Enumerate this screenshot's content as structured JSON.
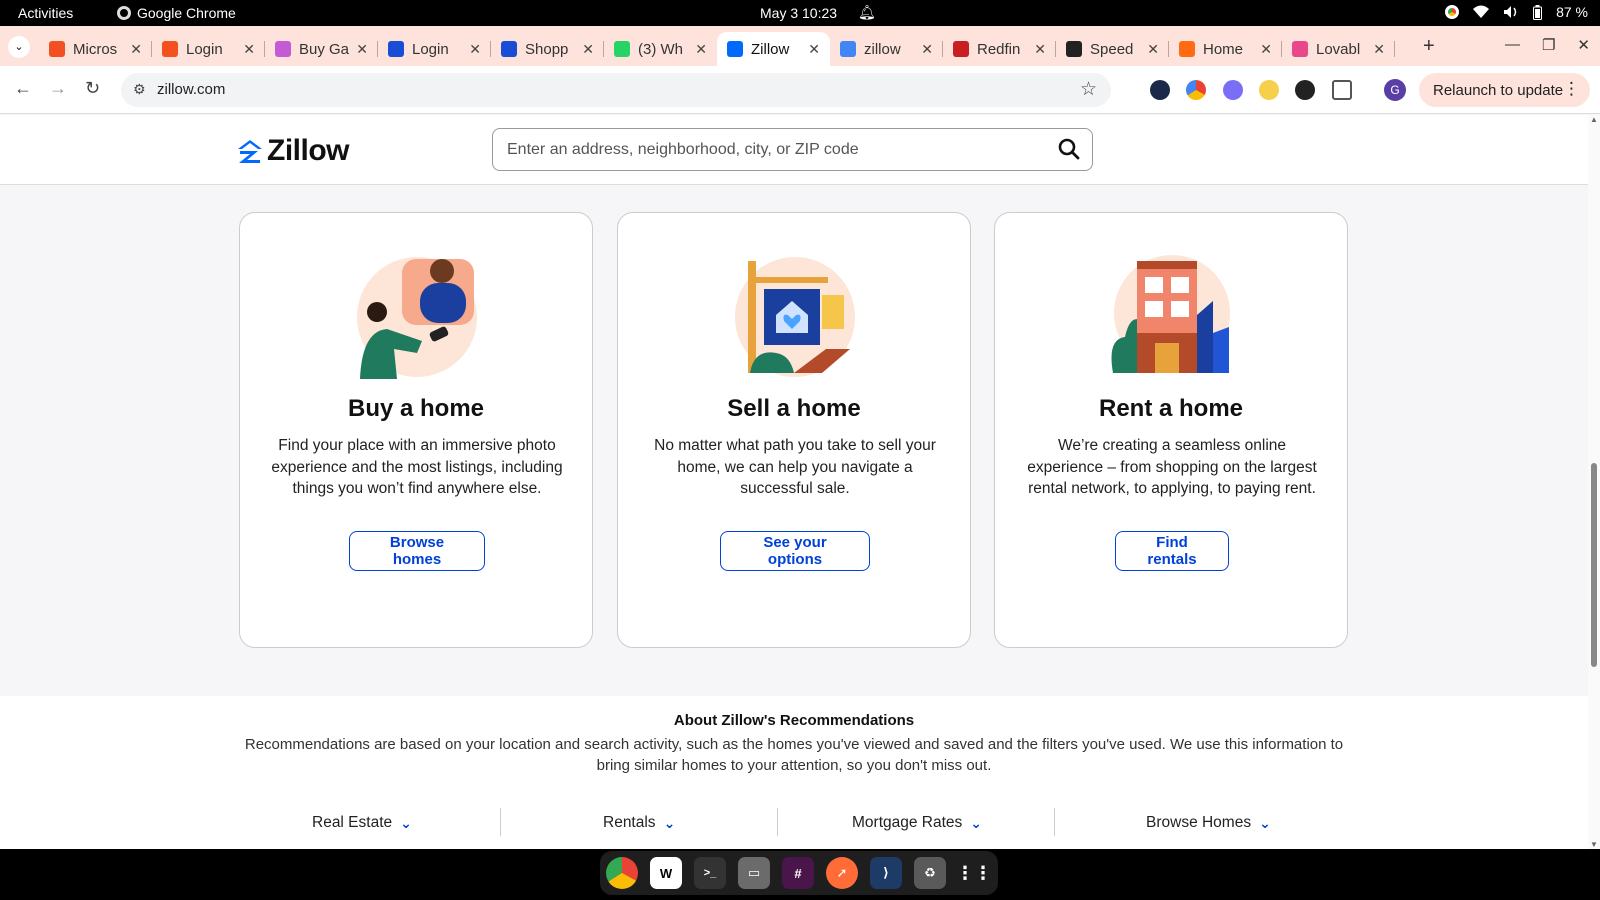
{
  "system_bar": {
    "activities": "Activities",
    "app_name": "Google Chrome",
    "clock": "May 3  10:23",
    "battery": "87 %"
  },
  "tabs": [
    {
      "title": "Micros",
      "color": "#f25022",
      "icon": "microsoft-icon"
    },
    {
      "title": "Login",
      "color": "#f4511e",
      "icon": "g-logo-icon"
    },
    {
      "title": "Buy Ga",
      "color": "#c45bd6",
      "icon": "pinwheel-icon"
    },
    {
      "title": "Login",
      "color": "#1a4dd6",
      "icon": "w-logo-icon"
    },
    {
      "title": "Shopp",
      "color": "#1a4dd6",
      "icon": "w-logo-icon"
    },
    {
      "title": "(3) Wh",
      "color": "#25d366",
      "icon": "whatsapp-icon"
    },
    {
      "title": "Zillow",
      "color": "#006aff",
      "icon": "zillow-icon"
    },
    {
      "title": "zillow",
      "color": "#4285f4",
      "icon": "google-icon"
    },
    {
      "title": "Redfin",
      "color": "#c82021",
      "icon": "redfin-icon"
    },
    {
      "title": "Speed",
      "color": "#222222",
      "icon": "speedtest-icon"
    },
    {
      "title": "Home",
      "color": "#ff6a13",
      "icon": "home-app-icon"
    },
    {
      "title": "Lovabl",
      "color": "#e8488b",
      "icon": "lovable-icon"
    }
  ],
  "active_tab_index": 6,
  "address_bar": {
    "url": "zillow.com",
    "relaunch_label": "Relaunch to update",
    "profile_initial": "G"
  },
  "zillow": {
    "brand": "Zillow",
    "brand_color": "#006aff",
    "search_placeholder": "Enter an address, neighborhood, city, or ZIP code",
    "cards": [
      {
        "title": "Buy a home",
        "description": "Find your place with an immersive photo experience and the most listings, including things you won’t find anywhere else.",
        "cta": "Browse homes"
      },
      {
        "title": "Sell a home",
        "description": "No matter what path you take to sell your home, we can help you navigate a successful sale.",
        "cta": "See your options"
      },
      {
        "title": "Rent a home",
        "description": "We’re creating a seamless online experience – from shopping on the largest rental network, to applying, to paying rent.",
        "cta": "Find rentals"
      }
    ],
    "about": {
      "heading": "About Zillow's Recommendations",
      "text": "Recommendations are based on your location and search activity, such as the homes you've viewed and saved and the filters you've used. We use this information to bring similar homes to your attention, so you don't miss out."
    },
    "footer_nav": [
      "Real Estate",
      "Rentals",
      "Mortgage Rates",
      "Browse Homes"
    ]
  },
  "dock": [
    "chrome-icon",
    "wps-icon",
    "terminal-icon",
    "files-icon",
    "slack-icon",
    "postman-icon",
    "vscode-icon",
    "trash-icon",
    "app-grid-icon"
  ]
}
